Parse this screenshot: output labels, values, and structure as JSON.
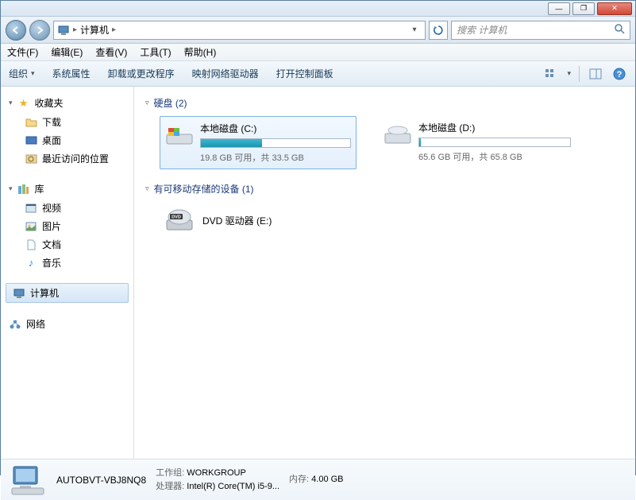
{
  "titlebar": {
    "min": "—",
    "max": "❐",
    "close": "✕"
  },
  "nav": {
    "crumb": "计算机",
    "sep": "▸",
    "search_placeholder": "搜索 计算机"
  },
  "menu": {
    "file": "文件(F)",
    "edit": "编辑(E)",
    "view": "查看(V)",
    "tools": "工具(T)",
    "help": "帮助(H)"
  },
  "toolbar": {
    "organize": "组织",
    "properties": "系统属性",
    "uninstall": "卸载或更改程序",
    "map_drive": "映射网络驱动器",
    "control_panel": "打开控制面板"
  },
  "sidebar": {
    "favorites": "收藏夹",
    "downloads": "下载",
    "desktop": "桌面",
    "recent": "最近访问的位置",
    "libraries": "库",
    "videos": "视频",
    "pictures": "图片",
    "documents": "文档",
    "music": "音乐",
    "computer": "计算机",
    "network": "网络"
  },
  "sections": {
    "hdd": "硬盘 (2)",
    "removable": "有可移动存储的设备 (1)"
  },
  "drives": {
    "c": {
      "name": "本地磁盘 (C:)",
      "text": "19.8 GB 可用，共 33.5 GB",
      "fill_pct": 41
    },
    "d": {
      "name": "本地磁盘 (D:)",
      "text": "65.6 GB 可用，共 65.8 GB",
      "fill_pct": 1
    },
    "dvd": {
      "name": "DVD 驱动器 (E:)"
    }
  },
  "details": {
    "name": "AUTOBVT-VBJ8NQ8",
    "workgroup_label": "工作组:",
    "workgroup": "WORKGROUP",
    "memory_label": "内存:",
    "memory": "4.00 GB",
    "cpu_label": "处理器:",
    "cpu": "Intel(R) Core(TM) i5-9..."
  }
}
